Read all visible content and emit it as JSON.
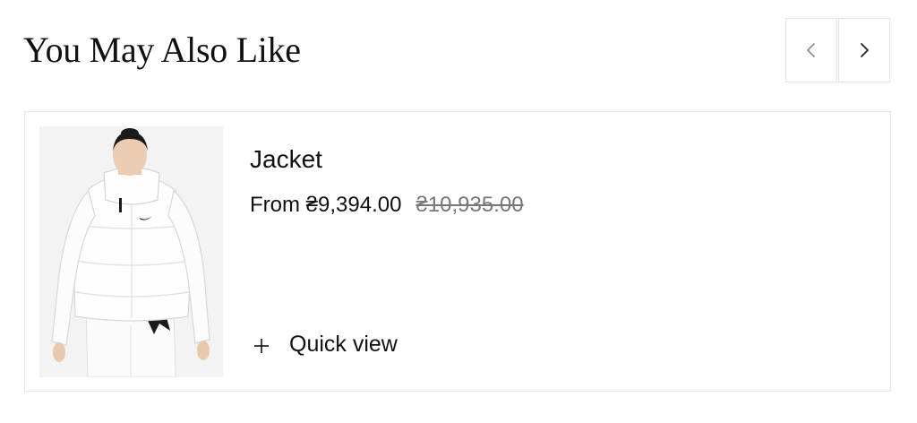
{
  "section": {
    "title": "You May Also Like"
  },
  "navigation": {
    "prev_icon": "chevron-left-icon",
    "next_icon": "chevron-right-icon"
  },
  "product": {
    "title": "Jacket",
    "price": "From ₴9,394.00",
    "compare_price": "₴10,935.00",
    "quick_view_label": "Quick view",
    "quick_view_icon": "plus-icon",
    "image_description_icon": "product-photo"
  }
}
